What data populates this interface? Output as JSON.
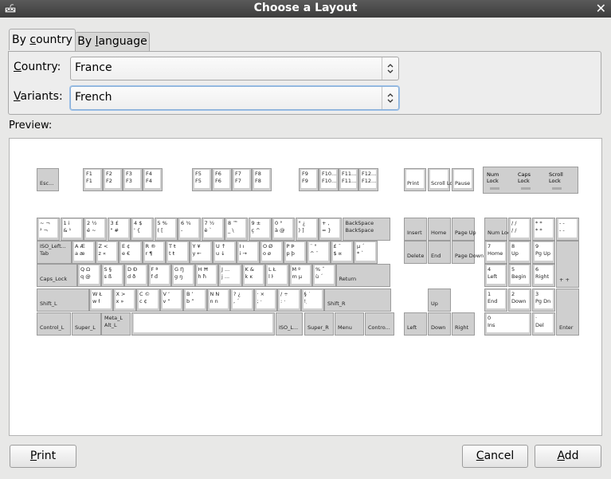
{
  "window": {
    "title": "Choose a Layout",
    "close_icon": "close-icon"
  },
  "tabs": [
    {
      "label_pre": "By ",
      "label_u": "c",
      "label_post": "ountry"
    },
    {
      "label_pre": "By ",
      "label_u": "l",
      "label_post": "anguage"
    }
  ],
  "country": {
    "label_u": "C",
    "label_rest": "ountry:",
    "value": "France"
  },
  "variants": {
    "label_u": "V",
    "label_rest": "ariants:",
    "value": "French"
  },
  "preview_label": "Preview:",
  "buttons": {
    "print": {
      "u": "P",
      "rest": "rint"
    },
    "cancel": {
      "u": "C",
      "rest": "ancel"
    },
    "add": {
      "u": "A",
      "rest": "dd"
    }
  },
  "keyboard": {
    "function_row": [
      "Esc...",
      "F1|F1|F1|F1",
      "F2|F2|F2|F2",
      "F3|F3|F3|F3",
      "F4|F4|F4|F4",
      "F5|F5|F5|F5",
      "F6|F6|F6|F6",
      "F7|F7|F7|F7",
      "F8|F8|F8|F8",
      "F9|F9|F9|F9",
      "F10...|F10...",
      "F11...|F11...",
      "F12...|F12...",
      "Print",
      "Scroll Lock",
      "Pause"
    ],
    "lock_indicators": [
      "Num Lock",
      "Caps Lock",
      "Scroll Lock"
    ],
    "row1": [
      "~ ¬|² ¬",
      "1 i|& ¹",
      "2 ½|é ~",
      "3 £|\" #",
      "4 $|' {",
      "5 %|( [",
      "6 ¾|- |",
      "7 ½|è `",
      "8 ™|_ \\",
      "9 ±|ç ^",
      "0 °|à @",
      "° ¿|) ]",
      "+ ,|= }",
      "BackSpace|BackSpace"
    ],
    "row2": [
      "ISO_Left...|Tab",
      "A Æ|a æ",
      "Z <|z «",
      "E ¢|e €",
      "R ®|r ¶",
      "T ŧ|t ŧ",
      "Y ¥|y ←",
      "U ↑|u ↓",
      "I ı|i →",
      "O Ø|o ø",
      "P Þ|p þ",
      "¨ °|^ ¨",
      "£ ¯|$ ¤",
      "µ ´|* `"
    ],
    "row3": [
      "Caps_Lock",
      "Q Ω|q @",
      "S §|s ß",
      "D Ð|d ð",
      "F ª|f đ",
      "G Ŋ|g ŋ",
      "H Ħ|h ħ",
      "J ...|j ...",
      "K &|k ĸ",
      "L Ł|l ŀ",
      "M º|m µ",
      "% ˇ|ù ´",
      "Return"
    ],
    "row4": [
      "Shift_L",
      "W Ł|w ł",
      "X >|x »",
      "C ©|c ¢",
      "V ‘|v “",
      "B ’|b ”",
      "N N|n n",
      "? ¿|, ´",
      "· ×|; ·",
      "/ ÷|: ·",
      "§ ˙|! ̣",
      "Shift_R"
    ],
    "row5": [
      "Control_L",
      "Super_L",
      "Meta_L|Alt_L",
      "",
      "ISO_L...",
      "Super_R",
      "Menu",
      "Contro..."
    ],
    "nav": [
      "Insert",
      "Home",
      "Page Up",
      "Delete",
      "End",
      "Page Down",
      "Up",
      "Left",
      "Down",
      "Right"
    ],
    "numpad": [
      "Num Lock",
      "/ /|/ /",
      "* *|* *",
      "- -|- -",
      "7|Home",
      "8|Up",
      "9|Pg Up",
      "+ +",
      "4|Left",
      "5|Begin",
      "6|Right",
      "+ +",
      "1|End",
      "2|Down",
      "3|Pg Dn",
      "Enter",
      "0|Ins",
      "·|Del"
    ]
  }
}
